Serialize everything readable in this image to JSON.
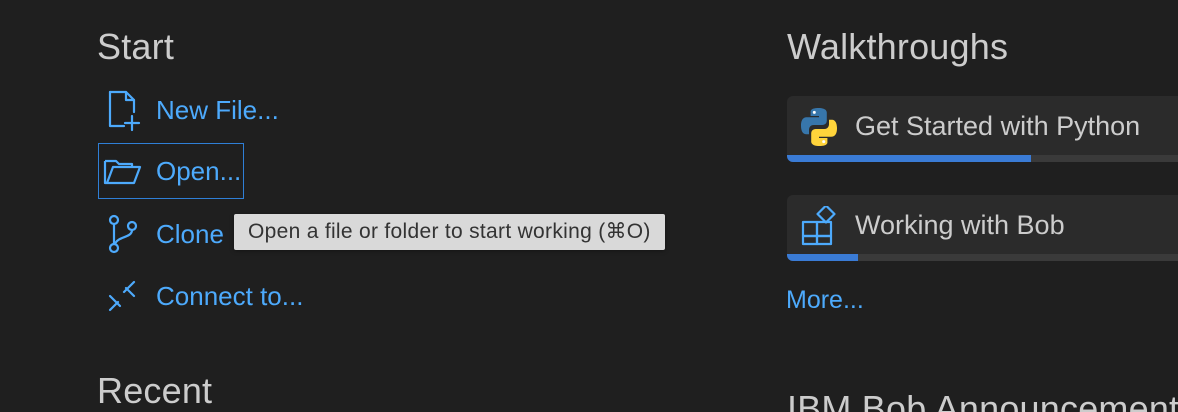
{
  "start": {
    "heading": "Start",
    "items": [
      {
        "label": "New File...",
        "icon": "new-file-icon"
      },
      {
        "label": "Open...",
        "icon": "folder-open-icon"
      },
      {
        "label": "Clone",
        "icon": "source-control-icon"
      },
      {
        "label": "Connect to...",
        "icon": "remote-connect-icon"
      }
    ]
  },
  "tooltip": {
    "text": "Open a file or folder to start working (⌘O)"
  },
  "recent": {
    "heading": "Recent"
  },
  "walkthroughs": {
    "heading": "Walkthroughs",
    "items": [
      {
        "title": "Get Started with Python",
        "icon": "python-logo-icon",
        "progress": 0.58
      },
      {
        "title": "Working with Bob",
        "icon": "extensions-icon",
        "progress": 0.17
      }
    ],
    "more_label": "More..."
  },
  "announcements": {
    "heading": "IBM Bob Announcements"
  },
  "colors": {
    "background": "#1f1f1f",
    "link": "#4daafc",
    "heading": "#cccccc",
    "card": "#2b2b2b",
    "progress": "#3a7bd5"
  }
}
